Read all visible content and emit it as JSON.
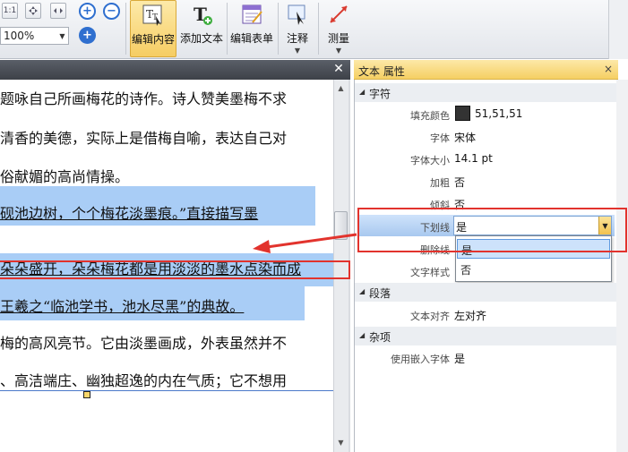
{
  "toolbar": {
    "zoom_value": "100%",
    "small_btn_label": "1:1",
    "buttons": [
      {
        "label": "编辑内容"
      },
      {
        "label": "添加文本"
      },
      {
        "label": "编辑表单"
      },
      {
        "label": "注释"
      },
      {
        "label": "测量"
      }
    ]
  },
  "document": {
    "lines": [
      "题咏自己所画梅花的诗作。诗人赞美墨梅不求",
      "清香的美德，实际上是借梅自喻，表达自己对",
      "俗献媚的高尚情操。",
      "砚池边树，个个梅花淡墨痕。”直接描写墨",
      "朵朵盛开，朵朵梅花都是用淡淡的墨水点染而成",
      "王羲之“临池学书，池水尽黑”的典故。",
      "梅的高风亮节。它由淡墨画成，外表虽然并不",
      "、高洁端庄、幽独超逸的内在气质；它不想用"
    ]
  },
  "panel": {
    "title": "文本 属性",
    "categories": {
      "char": "字符",
      "para": "段落",
      "misc": "杂项"
    },
    "rows": {
      "fill_color": {
        "label": "填充颜色",
        "value": "51,51,51"
      },
      "font": {
        "label": "字体",
        "value": "宋体"
      },
      "font_size": {
        "label": "字体大小",
        "value": "14.1 pt"
      },
      "bold": {
        "label": "加粗",
        "value": "否"
      },
      "italic": {
        "label": "倾斜",
        "value": "否"
      },
      "underline": {
        "label": "下划线",
        "value": "是"
      },
      "strike": {
        "label": "删除线",
        "value": ""
      },
      "text_style": {
        "label": "文字样式",
        "value": ""
      },
      "align": {
        "label": "文本对齐",
        "value": "左对齐"
      },
      "embed_font": {
        "label": "使用嵌入字体",
        "value": "是"
      }
    },
    "dropdown_options": [
      "是",
      "否"
    ]
  },
  "colors": {
    "fill_swatch": "#333333",
    "highlight": "#a9cdf6",
    "annotation_red": "#e2332d"
  }
}
